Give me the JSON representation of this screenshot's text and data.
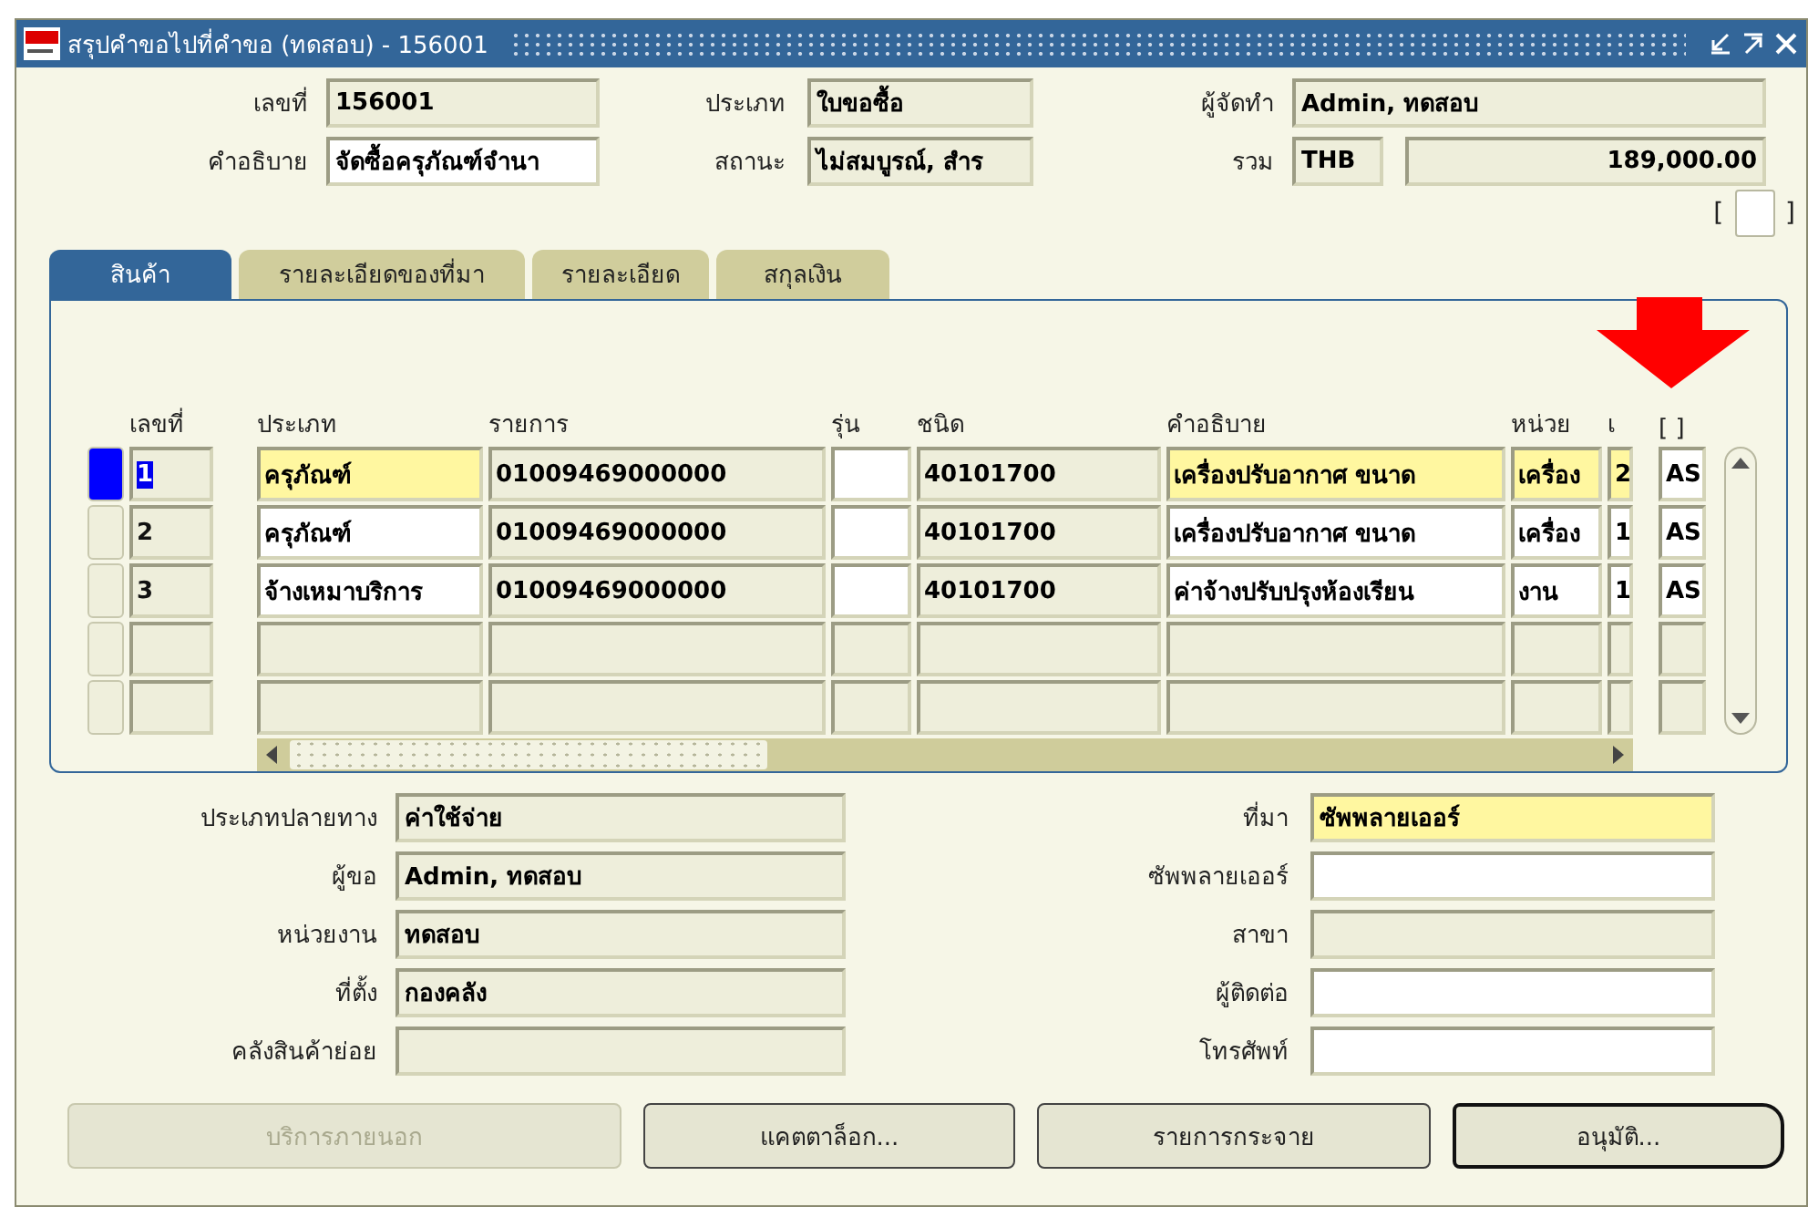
{
  "window": {
    "title": "สรุปคำขอไปที่คำขอ (ทดสอบ) - 156001"
  },
  "header": [
    {
      "label": "เลขที่",
      "value": "156001",
      "kind": "readonly"
    },
    {
      "label": "ประเภท",
      "value": "ใบขอซื้อ",
      "kind": "readonly"
    },
    {
      "label": "ผู้จัดทำ",
      "value": "Admin, ทดสอบ",
      "kind": "readonly"
    },
    {
      "label": "คำอธิบาย",
      "value": "จัดซื้อครุภัณฑ์จำนา",
      "kind": "editable"
    },
    {
      "label": "สถานะ",
      "value": "ไม่สมบูรณ์, สำร",
      "kind": "readonly"
    },
    {
      "label": "รวม",
      "value": "THB",
      "kind": "readonly"
    },
    {
      "value": "189,000.00",
      "kind": "readonly"
    }
  ],
  "flag": {
    "open": "[",
    "close": "]",
    "checked": false
  },
  "tabs": [
    {
      "label": "สินค้า",
      "selected": true
    },
    {
      "label": "รายละเอียดของที่มา",
      "selected": false
    },
    {
      "label": "รายละเอียด",
      "selected": false
    },
    {
      "label": "สกุลเงิน",
      "selected": false
    }
  ],
  "table": {
    "columns": [
      "เลขที่",
      "ประเภท",
      "รายการ",
      "รุ่น",
      "ชนิด",
      "คำอธิบาย",
      "หน่วย",
      "เ",
      "[ ]"
    ],
    "rows": [
      {
        "selected": true,
        "cells": [
          {
            "value": "1",
            "kind": "readonly"
          },
          {
            "value": "ครุภัณฑ์",
            "kind": "required"
          },
          {
            "value": "01009469000000",
            "kind": "readonly"
          },
          {
            "kind": "editable"
          },
          {
            "value": "40101700",
            "kind": "readonly"
          },
          {
            "value": "เครื่องปรับอากาศ ขนาด",
            "kind": "required"
          },
          {
            "value": "เครื่อง",
            "kind": "required"
          },
          {
            "value": "2",
            "kind": "required"
          },
          {
            "value": "AS",
            "kind": "editable"
          }
        ]
      },
      {
        "selected": false,
        "cells": [
          {
            "value": "2",
            "kind": "readonly"
          },
          {
            "value": "ครุภัณฑ์",
            "kind": "editable"
          },
          {
            "value": "01009469000000",
            "kind": "readonly"
          },
          {
            "kind": "editable"
          },
          {
            "value": "40101700",
            "kind": "readonly"
          },
          {
            "value": "เครื่องปรับอากาศ ขนาด",
            "kind": "editable"
          },
          {
            "value": "เครื่อง",
            "kind": "editable"
          },
          {
            "value": "1",
            "kind": "editable"
          },
          {
            "value": "AS",
            "kind": "editable"
          }
        ]
      },
      {
        "selected": false,
        "cells": [
          {
            "value": "3",
            "kind": "readonly"
          },
          {
            "value": "จ้างเหมาบริการ",
            "kind": "editable"
          },
          {
            "value": "01009469000000",
            "kind": "readonly"
          },
          {
            "kind": "editable"
          },
          {
            "value": "40101700",
            "kind": "readonly"
          },
          {
            "value": "ค่าจ้างปรับปรุงห้องเรียน",
            "kind": "editable"
          },
          {
            "value": "งาน",
            "kind": "editable"
          },
          {
            "value": "1",
            "kind": "editable"
          },
          {
            "value": "AS",
            "kind": "editable"
          }
        ]
      },
      {
        "selected": false,
        "cells": [
          {
            "kind": "readonly"
          },
          {
            "kind": "readonly"
          },
          {
            "kind": "readonly"
          },
          {
            "kind": "readonly"
          },
          {
            "kind": "readonly"
          },
          {
            "kind": "readonly"
          },
          {
            "kind": "readonly"
          },
          {
            "kind": "readonly"
          },
          {
            "kind": "readonly"
          }
        ]
      },
      {
        "selected": false,
        "cells": [
          {
            "kind": "readonly"
          },
          {
            "kind": "readonly"
          },
          {
            "kind": "readonly"
          },
          {
            "kind": "readonly"
          },
          {
            "kind": "readonly"
          },
          {
            "kind": "readonly"
          },
          {
            "kind": "readonly"
          },
          {
            "kind": "readonly"
          },
          {
            "kind": "readonly"
          }
        ]
      }
    ]
  },
  "details_left": [
    {
      "label": "ประเภทปลายทาง",
      "value": "ค่าใช้จ่าย",
      "kind": "readonly"
    },
    {
      "label": "ผู้ขอ",
      "value": "Admin, ทดสอบ",
      "kind": "readonly"
    },
    {
      "label": "หน่วยงาน",
      "value": "ทดสอบ",
      "kind": "readonly"
    },
    {
      "label": "ที่ตั้ง",
      "value": "กองคลัง",
      "kind": "readonly"
    },
    {
      "label": "คลังสินค้าย่อย",
      "kind": "readonly"
    }
  ],
  "details_right": [
    {
      "label": "ที่มา",
      "value": "ซัพพลายเออร์",
      "kind": "required"
    },
    {
      "label": "ซัพพลายเออร์",
      "kind": "editable"
    },
    {
      "label": "สาขา",
      "kind": "readonly"
    },
    {
      "label": "ผู้ติดต่อ",
      "kind": "editable"
    },
    {
      "label": "โทรศัพท์",
      "kind": "editable"
    }
  ],
  "buttons": [
    {
      "label": "บริการภายนอก",
      "disabled": true,
      "focused": false
    },
    {
      "label": "แคตตาล็อก...",
      "disabled": false,
      "focused": false
    },
    {
      "label": "รายการกระจาย",
      "disabled": false,
      "focused": false
    },
    {
      "label": "อนุมัติ...",
      "disabled": false,
      "focused": true
    }
  ]
}
